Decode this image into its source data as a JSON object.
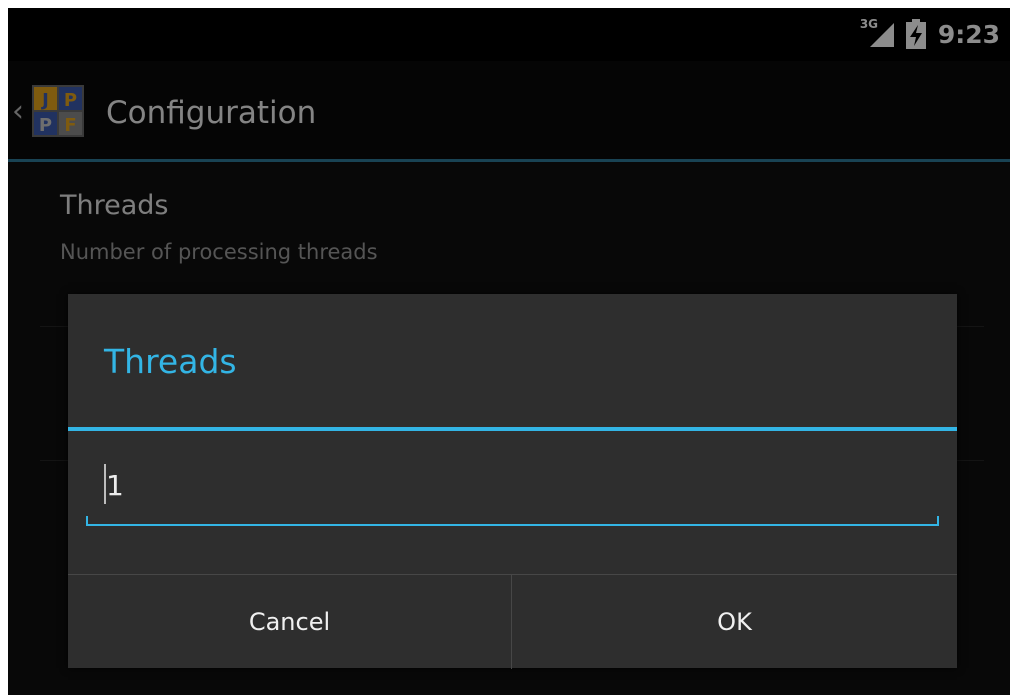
{
  "status_bar": {
    "network_type": "3G",
    "time": "9:23",
    "icons": [
      "signal-icon",
      "battery-charging-icon"
    ]
  },
  "action_bar": {
    "title": "Configuration",
    "logo": {
      "name": "jpf-logo",
      "letters": [
        "J",
        "P",
        "P",
        "F"
      ],
      "colors": {
        "tile_blue": "#3d5bb0",
        "tile_orange": "#e7a61c",
        "tile_gray": "#8a8a8a",
        "letter_light": "#c9c9c9"
      }
    },
    "accent_line_color": "#2f7a99"
  },
  "preference": {
    "title": "Threads",
    "summary": "Number of processing threads"
  },
  "dialog": {
    "title": "Threads",
    "input_value": "1",
    "cancel_label": "Cancel",
    "ok_label": "OK",
    "accent_color": "#33b5e5",
    "background_color": "#2e2e2e"
  }
}
